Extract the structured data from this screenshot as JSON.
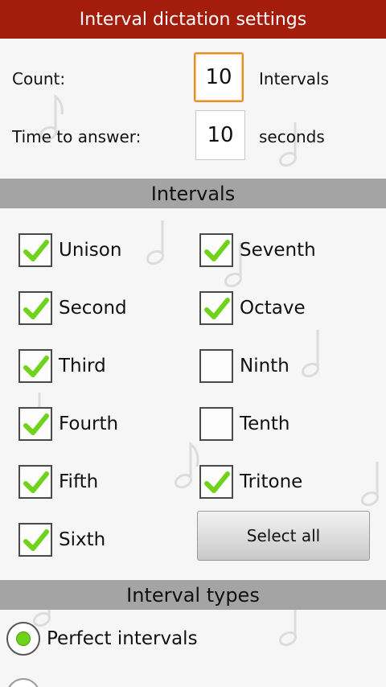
{
  "title": "Interval dictation settings",
  "count": {
    "label": "Count:",
    "value": "10",
    "unit": "Intervals"
  },
  "time": {
    "label": "Time to answer:",
    "value": "10",
    "unit": "seconds"
  },
  "intervals_header": "Intervals",
  "intervals": [
    {
      "label": "Unison",
      "checked": true
    },
    {
      "label": "Seventh",
      "checked": true
    },
    {
      "label": "Second",
      "checked": true
    },
    {
      "label": "Octave",
      "checked": true
    },
    {
      "label": "Third",
      "checked": true
    },
    {
      "label": "Ninth",
      "checked": false
    },
    {
      "label": "Fourth",
      "checked": true
    },
    {
      "label": "Tenth",
      "checked": false
    },
    {
      "label": "Fifth",
      "checked": true
    },
    {
      "label": "Tritone",
      "checked": true
    },
    {
      "label": "Sixth",
      "checked": true
    }
  ],
  "select_all_label": "Select all",
  "types_header": "Interval types",
  "types": [
    {
      "label": "Perfect intervals",
      "selected": true
    }
  ],
  "colors": {
    "titlebar": "#a41d0c",
    "focus": "#e98d25",
    "check": "#6fd21b"
  }
}
